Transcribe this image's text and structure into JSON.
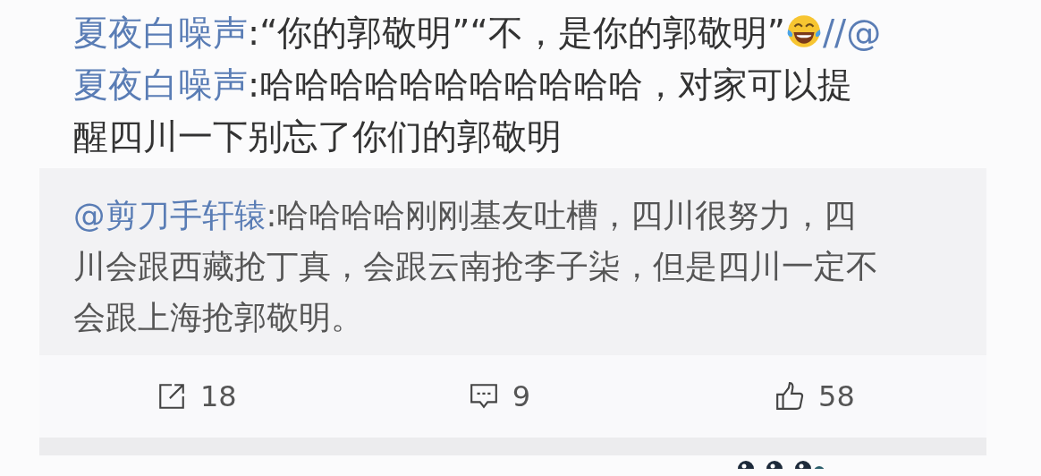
{
  "post": {
    "lines": [
      [
        {
          "kind": "user",
          "text": "夏夜白噪声"
        },
        {
          "kind": "text",
          "text": ":“你的郭敬明”“不，是你的郭敬明”"
        },
        {
          "kind": "emoji"
        },
        {
          "kind": "user",
          "text": "//@"
        }
      ],
      [
        {
          "kind": "user",
          "text": "夏夜白噪声"
        },
        {
          "kind": "text",
          "text": ":哈哈哈哈哈哈哈哈哈哈哈，对家可以提"
        }
      ],
      [
        {
          "kind": "text",
          "text": "醒四川一下别忘了你们的郭敬明"
        }
      ]
    ]
  },
  "quote": {
    "lines": [
      [
        {
          "kind": "user",
          "text": "@剪刀手轩辕"
        },
        {
          "kind": "text",
          "text": ":哈哈哈哈刚刚基友吐槽，四川很努力，四"
        }
      ],
      [
        {
          "kind": "text",
          "text": "川会跟西藏抢丁真，会跟云南抢李子柒，但是四川一定不"
        }
      ],
      [
        {
          "kind": "text",
          "text": "会跟上海抢郭敬明。"
        }
      ]
    ]
  },
  "actions": [
    {
      "kind": "share",
      "count": "18"
    },
    {
      "kind": "comment",
      "count": "9"
    },
    {
      "kind": "like",
      "count": "58"
    }
  ]
}
